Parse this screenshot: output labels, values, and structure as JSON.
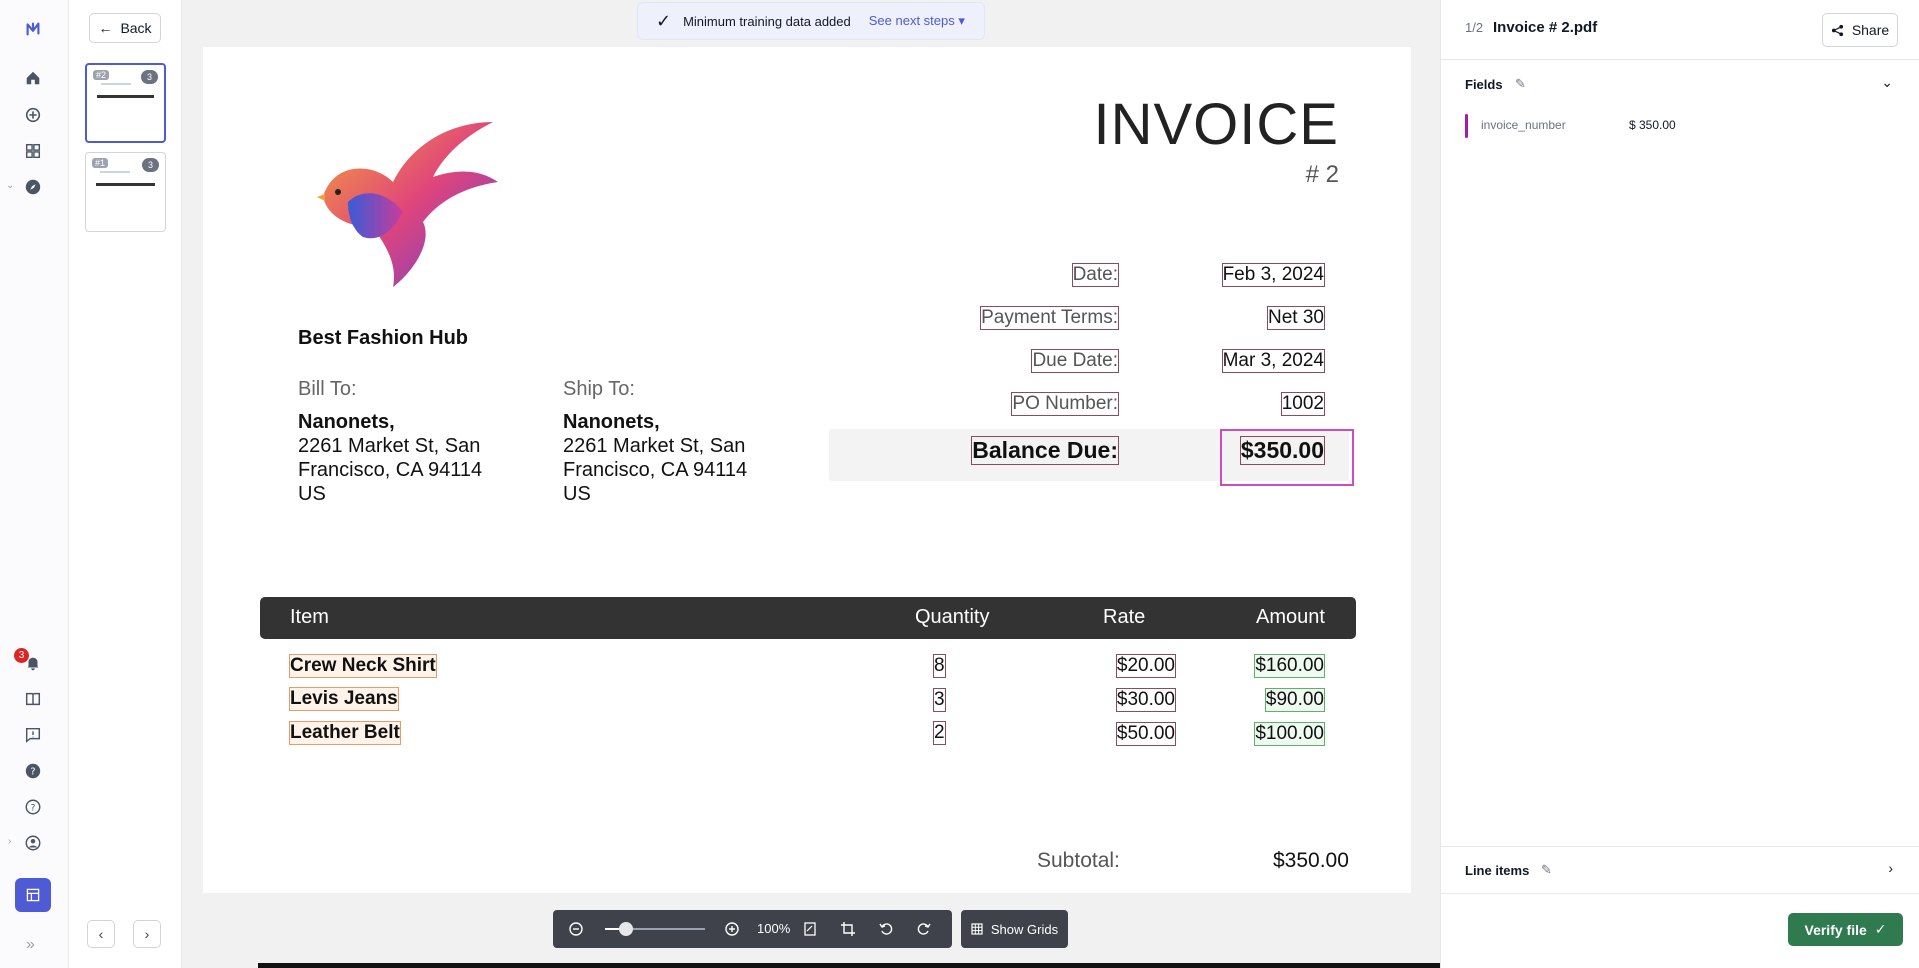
{
  "rail": {
    "notification_count": "3",
    "icons": [
      "nanonets-logo-icon",
      "home-icon",
      "add-circle-icon",
      "apps-icon",
      "compass-icon",
      "bell-icon",
      "book-icon",
      "feedback-icon",
      "help-icon",
      "question-icon",
      "user-icon",
      "expand-icon",
      "grid-icon"
    ]
  },
  "thumbs": {
    "back_label": "Back",
    "items": [
      {
        "label": "#2",
        "count": "3"
      },
      {
        "label": "#1",
        "count": "3"
      }
    ]
  },
  "toast": {
    "message": "Minimum training data added",
    "link": "See next steps"
  },
  "invoice": {
    "title": "INVOICE",
    "number": "# 2",
    "company": "Best Fashion Hub",
    "bill_to_label": "Bill To:",
    "ship_to_label": "Ship To:",
    "bill_to": {
      "name": "Nanonets,",
      "line1": "2261 Market St, San",
      "line2": "Francisco, CA 94114",
      "line3": "US"
    },
    "ship_to": {
      "name": "Nanonets,",
      "line1": "2261 Market St, San",
      "line2": "Francisco, CA 94114",
      "line3": "US"
    },
    "meta": {
      "date_label": "Date:",
      "date": "Feb 3, 2024",
      "terms_label": "Payment Terms:",
      "terms": "Net 30",
      "due_label": "Due Date:",
      "due": "Mar 3, 2024",
      "po_label": "PO Number:",
      "po": "1002",
      "balance_label": "Balance Due:",
      "balance": "$350.00"
    },
    "table": {
      "headers": {
        "item": "Item",
        "quantity": "Quantity",
        "rate": "Rate",
        "amount": "Amount"
      },
      "rows": [
        {
          "item": "Crew Neck Shirt",
          "qty": "8",
          "rate": "$20.00",
          "amount": "$160.00"
        },
        {
          "item": "Levis Jeans",
          "qty": "3",
          "rate": "$30.00",
          "amount": "$90.00"
        },
        {
          "item": "Leather Belt",
          "qty": "2",
          "rate": "$50.00",
          "amount": "$100.00"
        }
      ]
    },
    "subtotal_label": "Subtotal:",
    "subtotal": "$350.00"
  },
  "toolbar": {
    "zoom": "100%",
    "grids_label": "Show Grids"
  },
  "right": {
    "pages": "1/2",
    "file_name": "Invoice # 2.pdf",
    "share_label": "Share",
    "fields_title": "Fields",
    "field": {
      "name": "invoice_number",
      "value": "$ 350.00",
      "color": "#a21caf"
    },
    "line_items_title": "Line items",
    "verify_label": "Verify file"
  },
  "colors": {
    "accent": "#4f5bd5",
    "verify": "#2f7a4f",
    "selection": "#d04ac0"
  }
}
